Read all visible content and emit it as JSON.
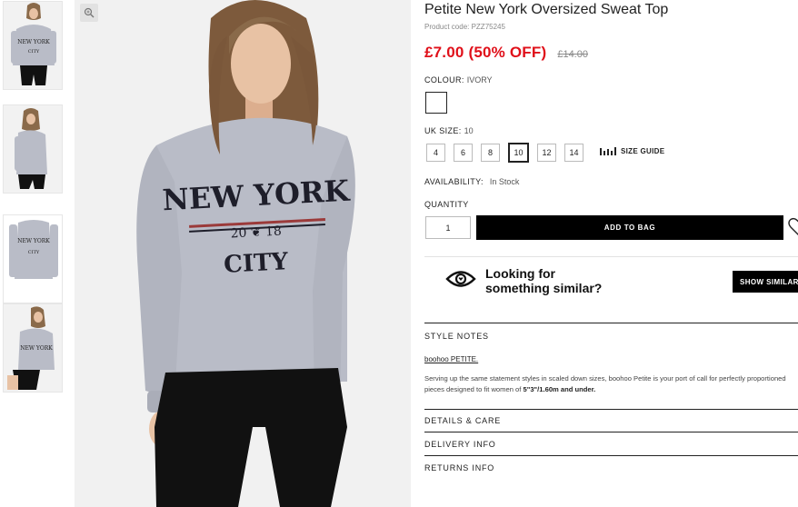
{
  "gallery": {
    "thumbnails": [
      {
        "name": "front-view"
      },
      {
        "name": "side-view"
      },
      {
        "name": "flat-view"
      },
      {
        "name": "seated-view"
      }
    ],
    "zoom_icon": "magnifier-zoom-icon"
  },
  "product": {
    "title": "Petite New York Oversized Sweat Top",
    "code": "Product code: PZZ75245",
    "price_now": "£7.00 (50% OFF)",
    "price_was": "£14.00",
    "colour_label": "COLOUR:",
    "colour_value": "IVORY",
    "size_label": "UK SIZE:",
    "size_value": "10",
    "sizes": [
      "4",
      "6",
      "8",
      "10",
      "12",
      "14"
    ],
    "selected_size": "10",
    "size_guide": "SIZE GUIDE",
    "availability_label": "AVAILABILITY:",
    "availability_value": "In Stock",
    "quantity_label": "QUANTITY",
    "quantity_value": "1",
    "add_to_bag": "ADD TO BAG"
  },
  "similar": {
    "line1": "Looking for",
    "line2": "something similar?",
    "button": "SHOW SIMILAR"
  },
  "style_notes": {
    "heading": "STYLE NOTES",
    "brand_link": "boohoo PETITE.",
    "description": "Serving up the same statement styles in scaled down sizes, boohoo Petite is your port of call for perfectly proportioned pieces designed to fit women of ",
    "description_bold": "5\"3\"/1.60m and under."
  },
  "sections": [
    "DETAILS & CARE",
    "DELIVERY INFO",
    "RETURNS INFO"
  ],
  "colors": {
    "sale_red": "#e0101a",
    "button_black": "#000000",
    "sweater_grey": "#b9bcc7"
  }
}
